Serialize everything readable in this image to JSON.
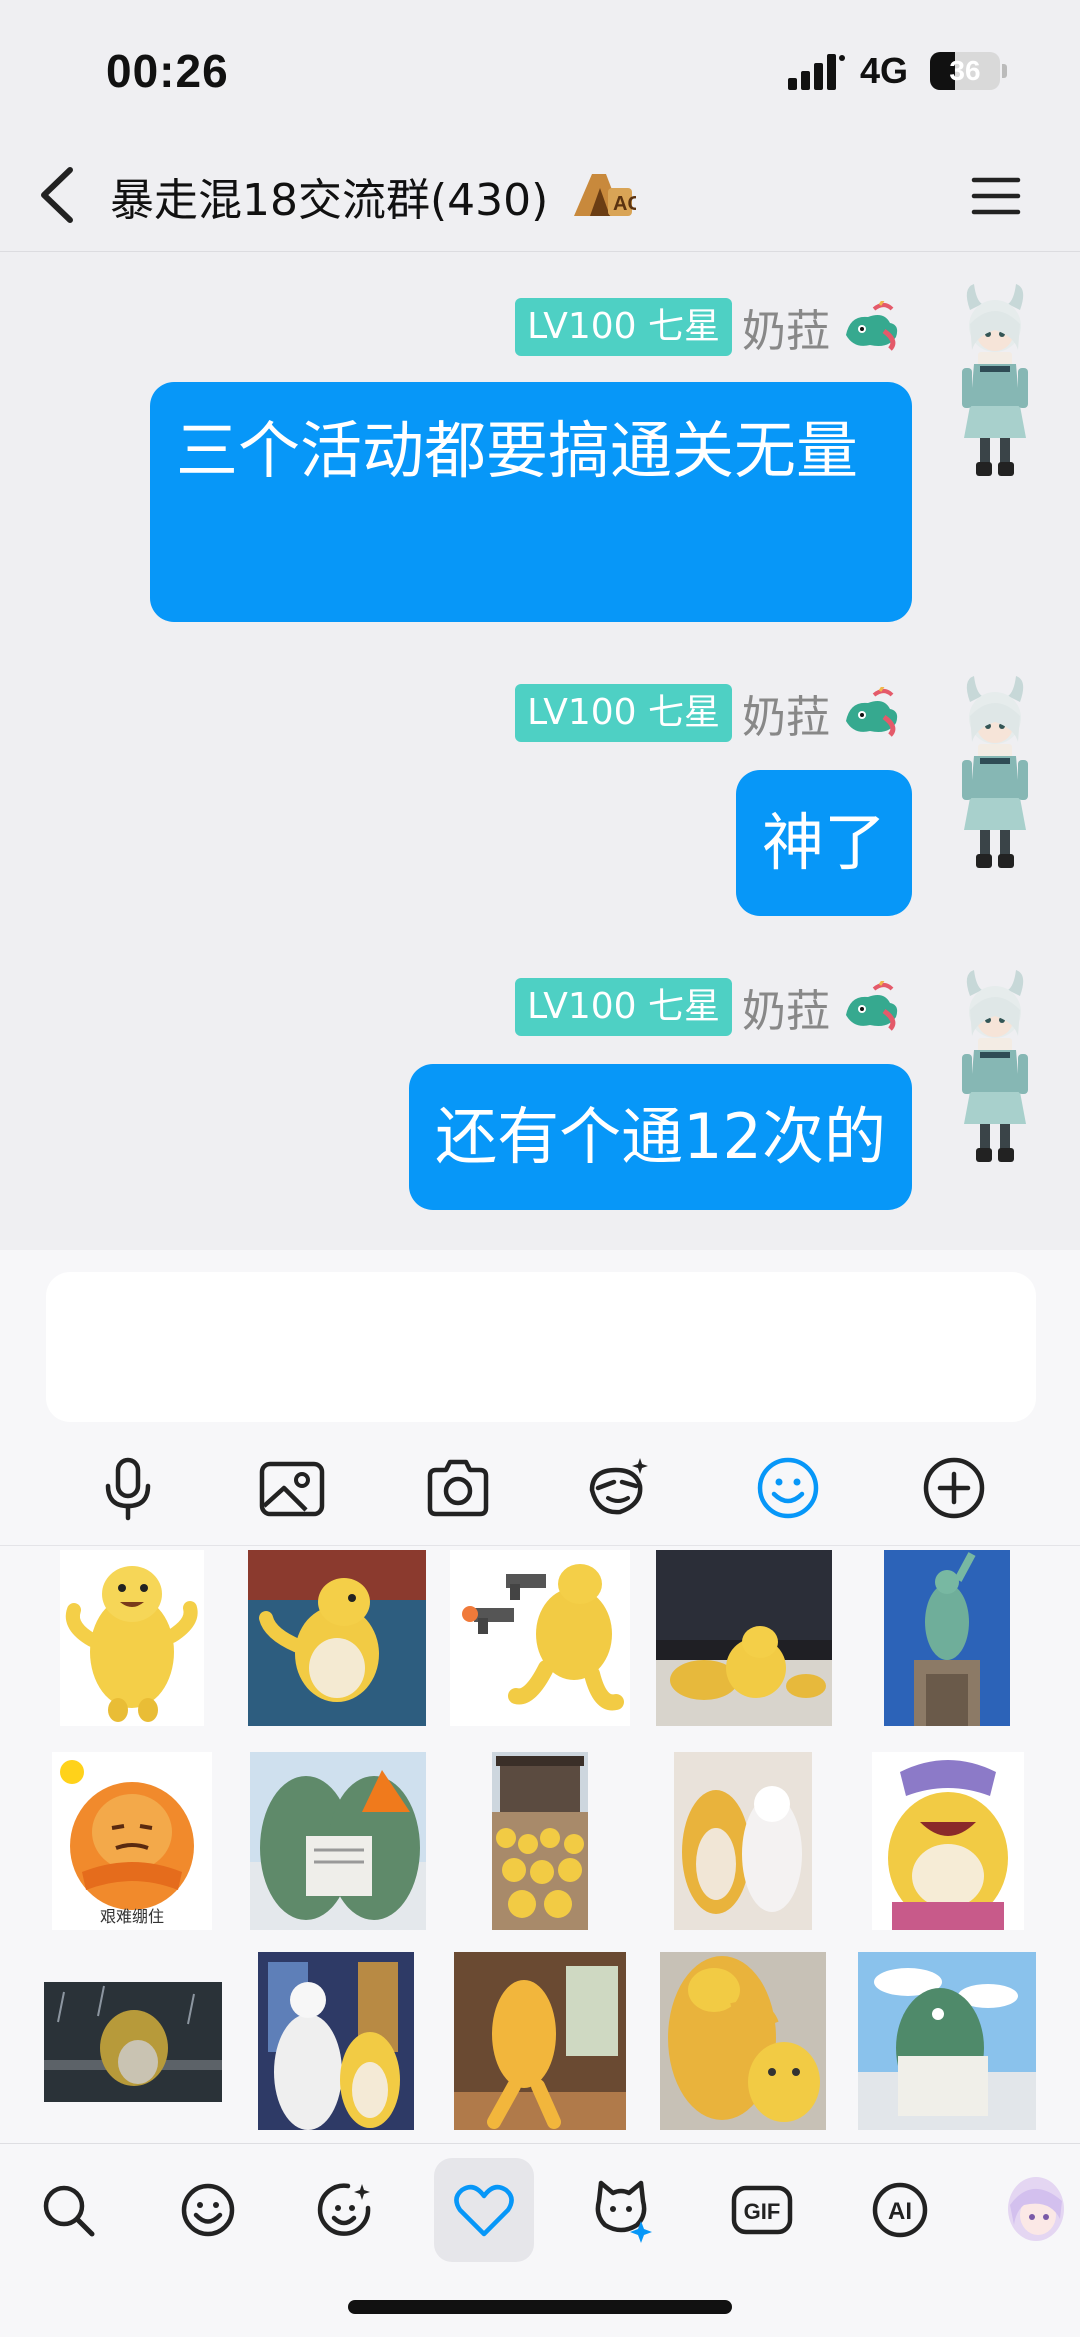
{
  "status_bar": {
    "time": "00:26",
    "network": "4G",
    "battery": "36",
    "battery_level_percent": 36
  },
  "nav": {
    "title": "暴走混18交流群(430)",
    "badge_text": "ACE"
  },
  "messages": [
    {
      "level": "LV100 七星",
      "nickname": "奶菈",
      "text": "三个活动都要搞通关无量"
    },
    {
      "level": "LV100 七星",
      "nickname": "奶菈",
      "text": "神了"
    },
    {
      "level": "LV100 七星",
      "nickname": "奶菈",
      "text": "还有个通12次的"
    }
  ],
  "composer": {
    "value": ""
  },
  "toolbar": [
    "microphone-icon",
    "image-icon",
    "camera-icon",
    "sticker-search-icon",
    "emoji-icon",
    "plus-icon"
  ],
  "toolbar_active": "emoji-icon",
  "stickers": {
    "caption_1": "艰难绷住"
  },
  "bottom_tabs": [
    "search-icon",
    "emoji-icon",
    "sparkle-face-icon",
    "heart-icon",
    "cat-star-icon",
    "gif-icon",
    "ai-icon",
    "avatar-icon"
  ],
  "bottom_tabs_text": {
    "gif": "GIF",
    "ai": "AI"
  },
  "bottom_active": "heart-icon",
  "colors": {
    "accent": "#0797f8",
    "badge": "#4ed0c4",
    "background": "#efeff2"
  }
}
